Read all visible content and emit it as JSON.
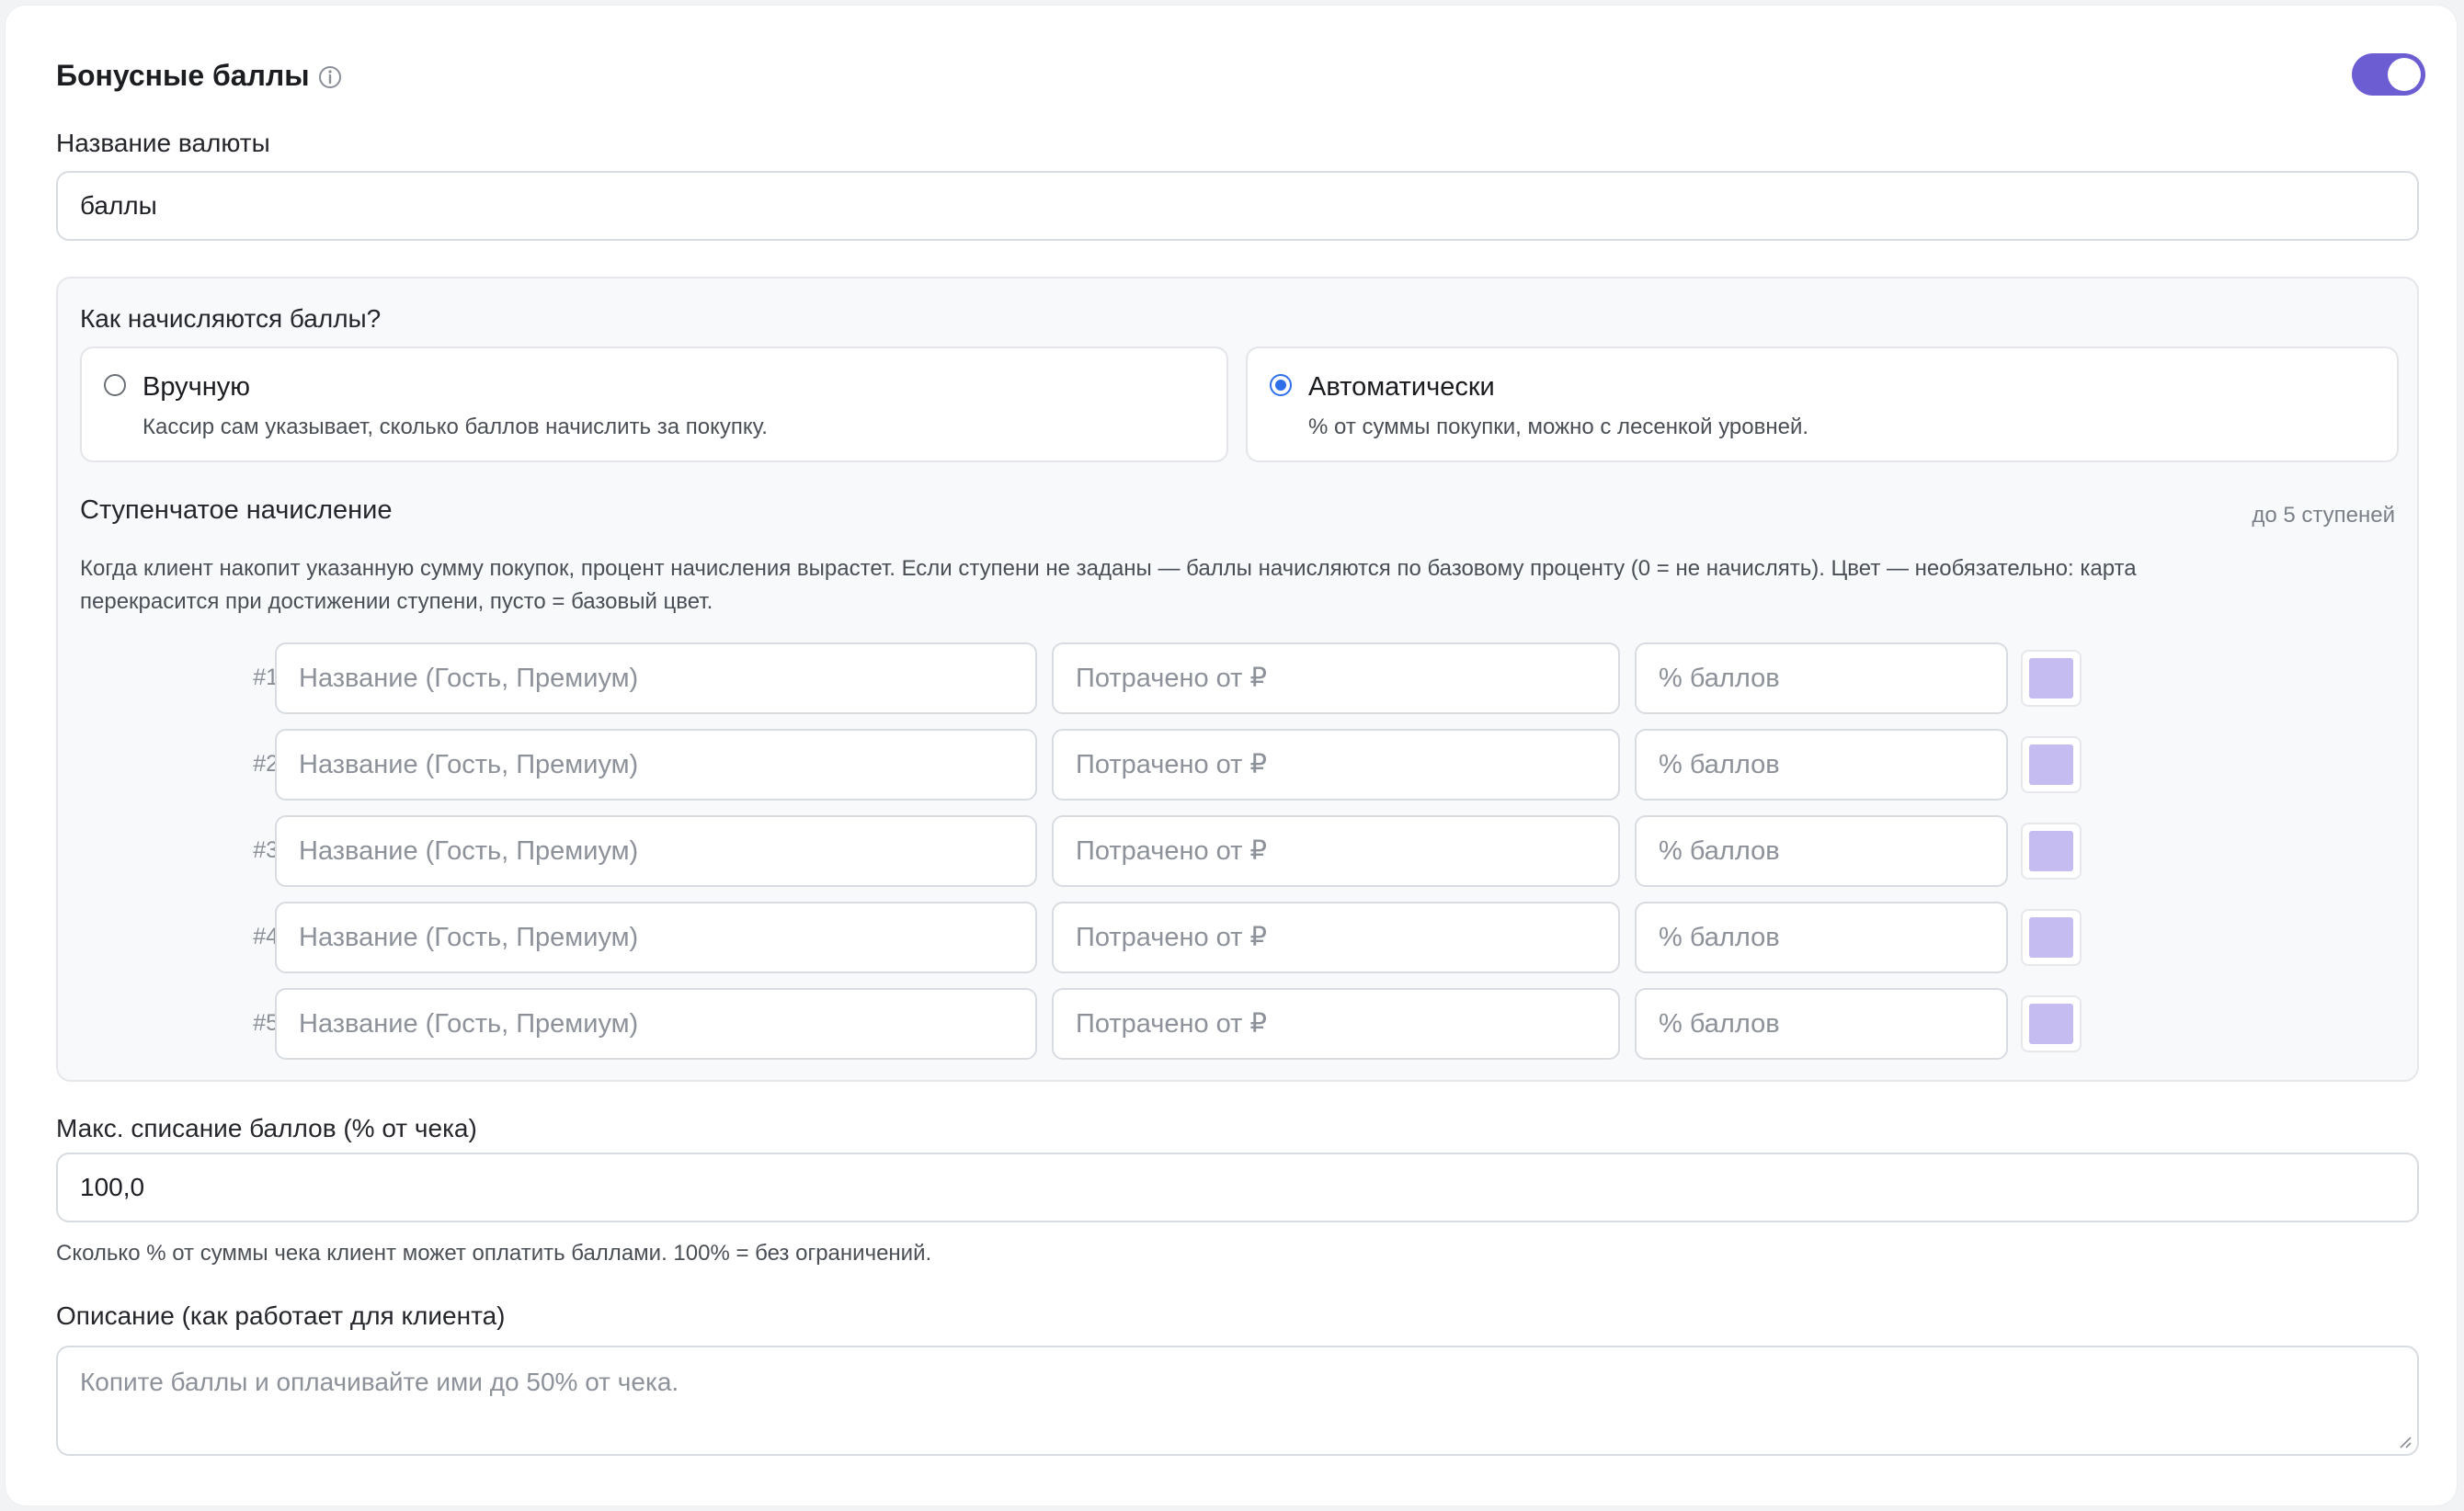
{
  "section": {
    "title": "Бонусные баллы",
    "info_icon": "info-icon",
    "toggle_on": true,
    "accent_color": "#6c5dd3"
  },
  "currency": {
    "label": "Название валюты",
    "value": "баллы"
  },
  "accrual": {
    "question": "Как начисляются баллы?",
    "options": [
      {
        "title": "Вручную",
        "description": "Кассир сам указывает, сколько баллов начислить за покупку.",
        "selected": false
      },
      {
        "title": "Автоматически",
        "description": "% от суммы покупки, можно с лесенкой уровней.",
        "selected": true
      }
    ]
  },
  "tiers": {
    "title": "Ступенчатое начисление",
    "limit": "до 5 ступеней",
    "help_line1": "Когда клиент накопит указанную сумму покупок, процент начисления вырастет. Если ступени не заданы — баллы начисляются по базовому проценту (0 = не начислять). Цвет — необязательно: карта",
    "help_line2": "перекрасится при достижении ступени, пусто = базовый цвет.",
    "name_placeholder": "Название (Гость, Премиум)",
    "spent_placeholder": "Потрачено от ₽",
    "percent_placeholder": "% баллов",
    "swatch_color": "#c5bdf2",
    "rows": [
      {
        "num": "#1"
      },
      {
        "num": "#2"
      },
      {
        "num": "#3"
      },
      {
        "num": "#4"
      },
      {
        "num": "#5"
      }
    ]
  },
  "max_writeoff": {
    "label": "Макс. списание баллов (% от чека)",
    "value": "100,0",
    "hint": "Сколько % от суммы чека клиент может оплатить баллами. 100% = без ограничений."
  },
  "description": {
    "label": "Описание (как работает для клиента)",
    "placeholder": "Копите баллы и оплачивайте ими до 50% от чека."
  }
}
